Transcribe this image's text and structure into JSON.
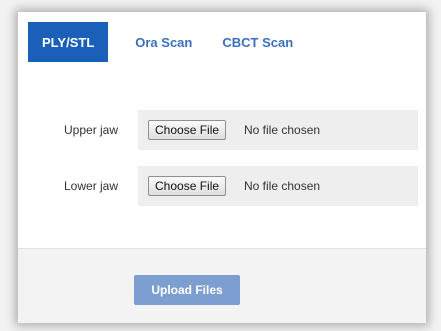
{
  "tabs": [
    {
      "label": "PLY/STL",
      "active": true
    },
    {
      "label": "Ora Scan",
      "active": false
    },
    {
      "label": "CBCT Scan",
      "active": false
    }
  ],
  "upper_jaw": {
    "label": "Upper jaw",
    "button_label": "Choose File",
    "status": "No file chosen"
  },
  "lower_jaw": {
    "label": "Lower jaw",
    "button_label": "Choose File",
    "status": "No file chosen"
  },
  "upload": {
    "label": "Upload Files"
  },
  "colors": {
    "active_tab_bg": "#1a5fb8",
    "tab_text": "#3a6fc0",
    "upload_button_bg": "#7d9ed0"
  }
}
